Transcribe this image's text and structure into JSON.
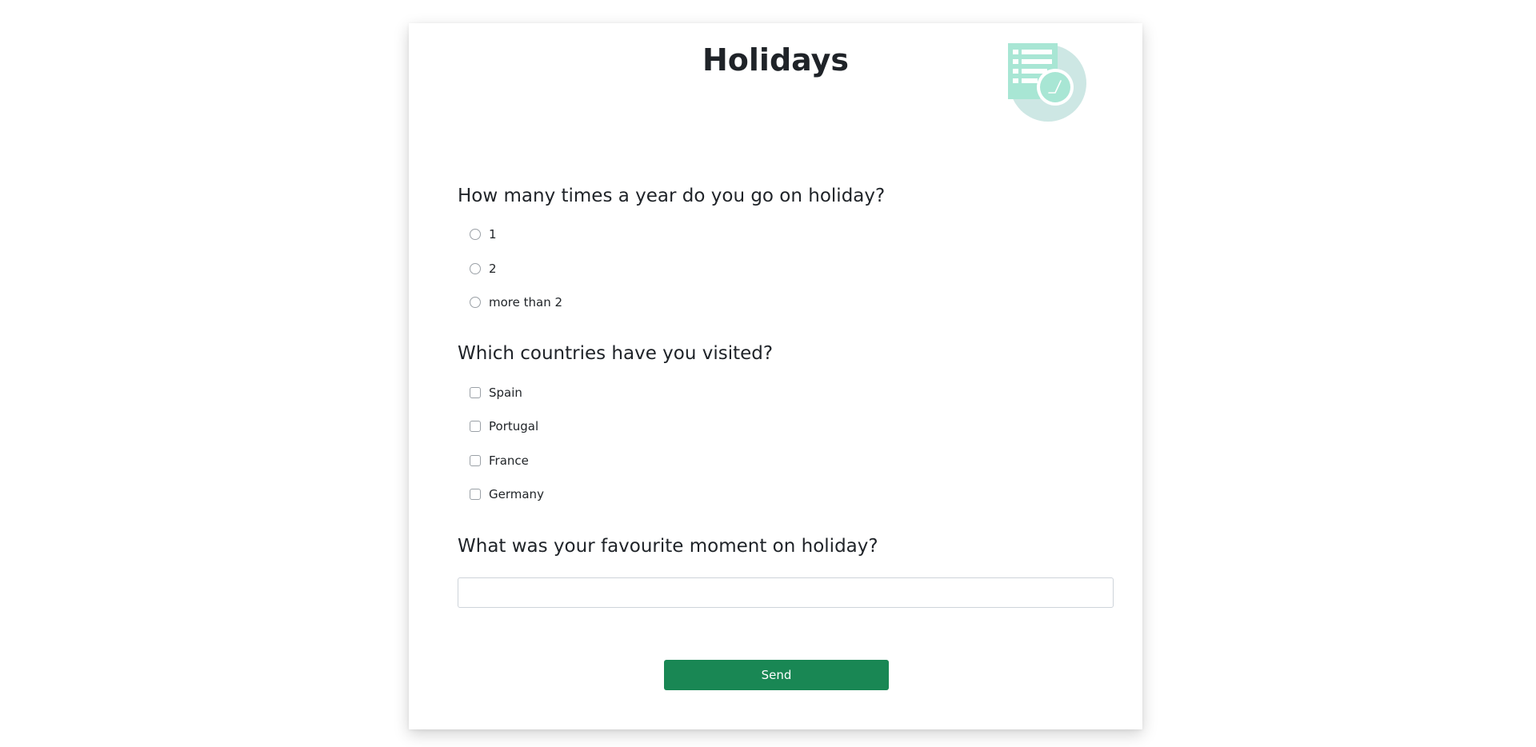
{
  "page": {
    "title": "Holidays",
    "logo_icon": "survey-checklist-clock-icon"
  },
  "colors": {
    "accent": "#198754",
    "logo_mint": "#a8e6d4",
    "logo_circle": "#cde7e4",
    "text": "#212529"
  },
  "questions": [
    {
      "text": "How many times a year do you go on holiday?",
      "type": "radio",
      "options": [
        "1",
        "2",
        "more than 2"
      ]
    },
    {
      "text": "Which countries have you visited?",
      "type": "checkbox",
      "options": [
        "Spain",
        "Portugal",
        "France",
        "Germany"
      ]
    },
    {
      "text": "What was your favourite moment on holiday?",
      "type": "text",
      "value": "",
      "placeholder": ""
    }
  ],
  "form": {
    "submit_label": "Send"
  }
}
